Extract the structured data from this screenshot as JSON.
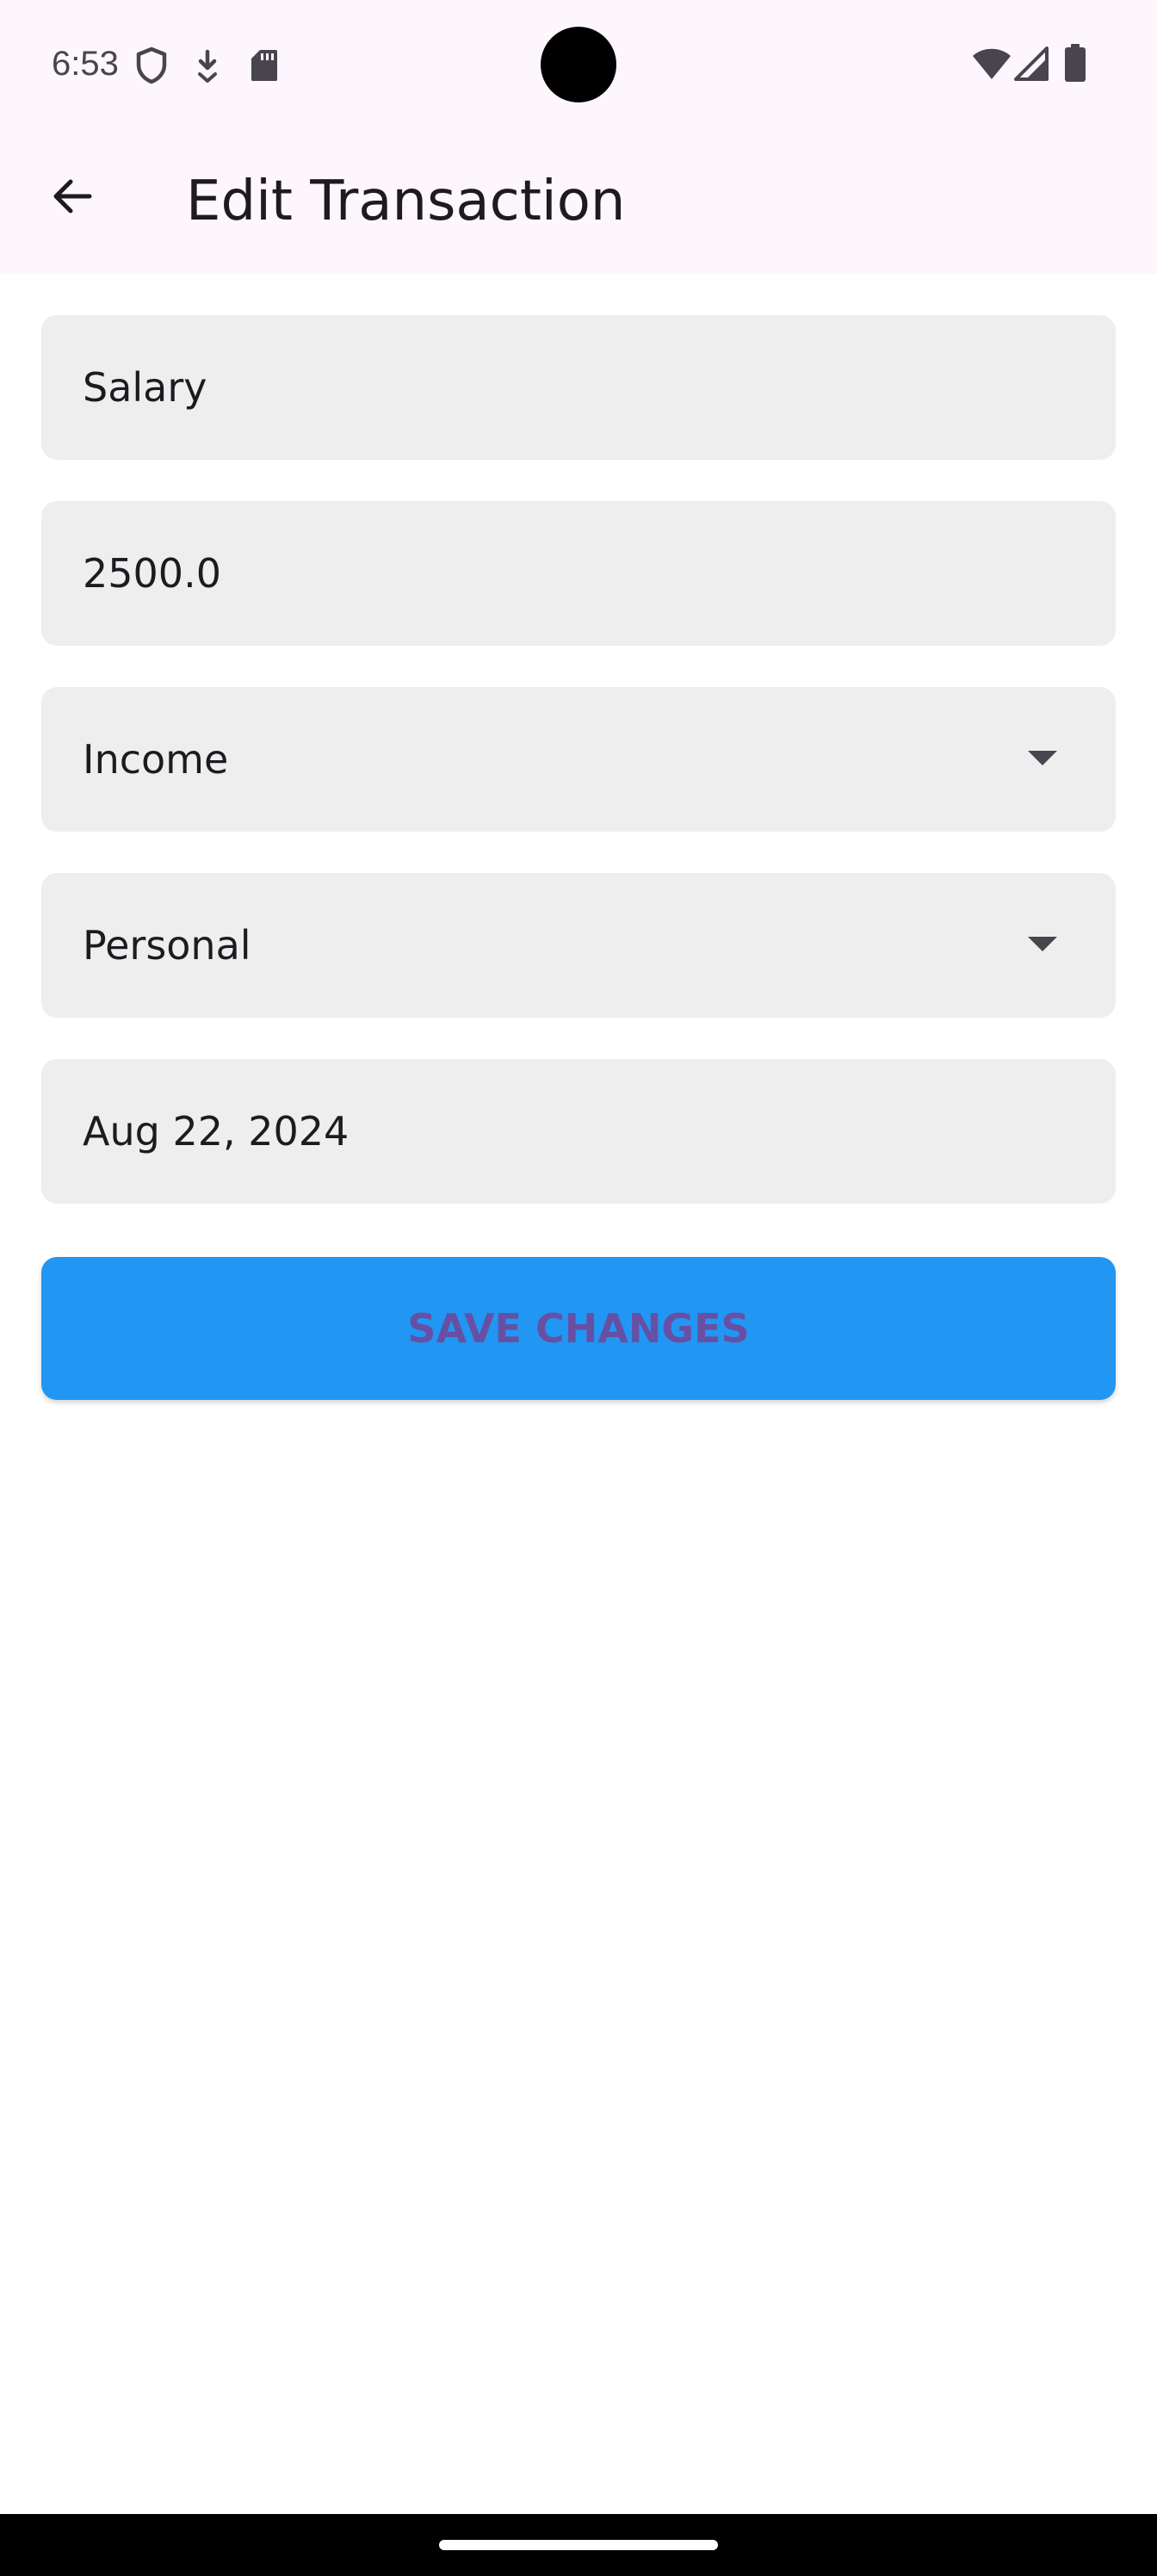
{
  "status_bar": {
    "time": "6:53",
    "left_icons": [
      "shield-icon",
      "download-icon",
      "sd-card-icon"
    ],
    "right_icons": [
      "wifi-icon",
      "cellular-signal-icon",
      "battery-icon"
    ]
  },
  "app_bar": {
    "back_icon": "arrow-back-icon",
    "title": "Edit Transaction"
  },
  "form": {
    "description_value": "Salary",
    "amount_value": "2500.0",
    "type_selected": "Income",
    "category_selected": "Personal",
    "date_value": "Aug 22, 2024",
    "dropdown_icon": "arrow-drop-down-icon"
  },
  "actions": {
    "save_label": "SAVE CHANGES"
  },
  "colors": {
    "app_bar_background": "#fdf7fd",
    "field_background": "#eeeeee",
    "button_background": "#2196f3",
    "button_text": "#6750a4",
    "nav_bar_background": "#000000"
  }
}
